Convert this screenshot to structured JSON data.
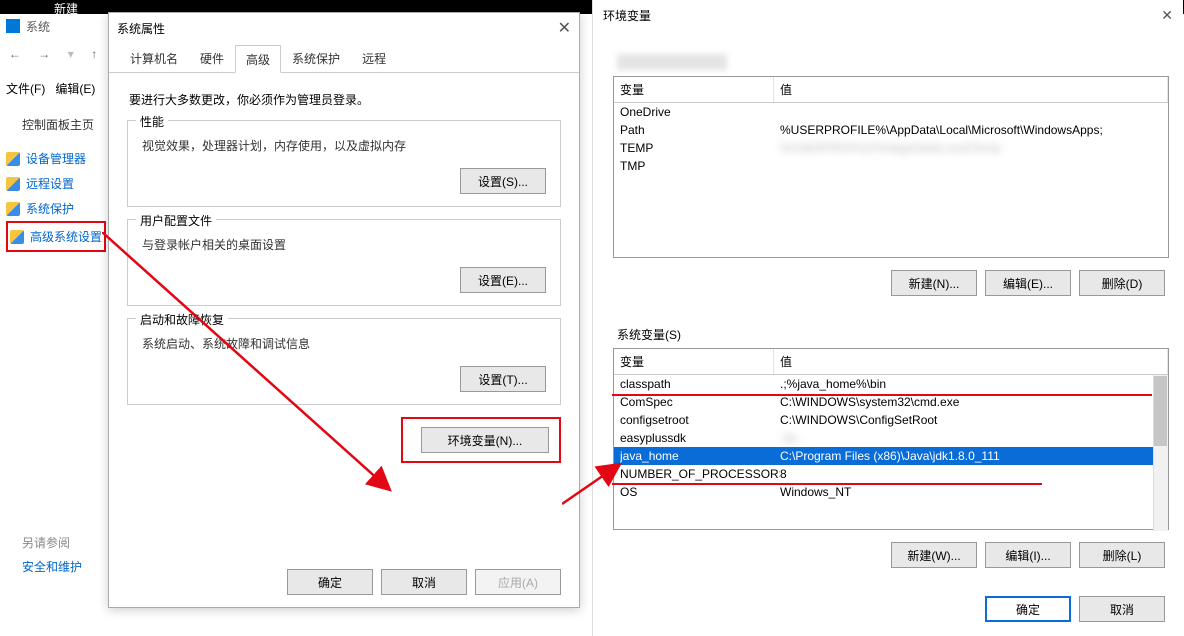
{
  "topbar": {
    "newtab": "新建"
  },
  "sysbar": {
    "label": "系统"
  },
  "menus": {
    "file": "文件(F)",
    "edit": "编辑(E)"
  },
  "nav_arrows": {
    "back": "←",
    "fwd": "→",
    "up": "↑"
  },
  "cp_home": "控制面板主页",
  "sidebar": {
    "items": [
      {
        "label": "设备管理器"
      },
      {
        "label": "远程设置"
      },
      {
        "label": "系统保护"
      },
      {
        "label": "高级系统设置"
      }
    ]
  },
  "seealso": "另请参阅",
  "sec_maint": "安全和维护",
  "sysprop": {
    "title": "系统属性",
    "tabs": {
      "computer_name": "计算机名",
      "hardware": "硬件",
      "advanced": "高级",
      "protection": "系统保护",
      "remote": "远程"
    },
    "admin_note": "要进行大多数更改，你必须作为管理员登录。",
    "perf": {
      "title": "性能",
      "desc": "视觉效果，处理器计划，内存使用，以及虚拟内存",
      "btn": "设置(S)..."
    },
    "profile": {
      "title": "用户配置文件",
      "desc": "与登录帐户相关的桌面设置",
      "btn": "设置(E)..."
    },
    "startup": {
      "title": "启动和故障恢复",
      "desc": "系统启动、系统故障和调试信息",
      "btn": "设置(T)..."
    },
    "env_btn": "环境变量(N)...",
    "ok": "确定",
    "cancel": "取消",
    "apply": "应用(A)"
  },
  "env": {
    "title": "环境变量",
    "col_var": "变量",
    "col_val": "值",
    "user_rows": [
      {
        "var": "OneDrive",
        "val": "",
        "blur_val": true
      },
      {
        "var": "Path",
        "val": "%USERPROFILE%\\AppData\\Local\\Microsoft\\WindowsApps;"
      },
      {
        "var": "TEMP",
        "val": "%USERPROFILE%\\AppData\\Local\\Temp",
        "blur_val": true
      },
      {
        "var": "TMP",
        "val": "",
        "blur_val": true
      }
    ],
    "sys_label": "系统变量(S)",
    "sys_rows": [
      {
        "var": "classpath",
        "val": ".;%java_home%\\bin"
      },
      {
        "var": "ComSpec",
        "val": "C:\\WINDOWS\\system32\\cmd.exe"
      },
      {
        "var": "configsetroot",
        "val": "C:\\WINDOWS\\ConfigSetRoot"
      },
      {
        "var": "easyplussdk",
        "val": ";\\bi...",
        "blur_val": true
      },
      {
        "var": "java_home",
        "val": "C:\\Program Files (x86)\\Java\\jdk1.8.0_111",
        "selected": true
      },
      {
        "var": "NUMBER_OF_PROCESSORS",
        "val": "8"
      },
      {
        "var": "OS",
        "val": "Windows_NT"
      }
    ],
    "new": "新建(N)...",
    "edit": "编辑(E)...",
    "del": "删除(D)",
    "new2": "新建(W)...",
    "edit2": "编辑(I)...",
    "del2": "删除(L)",
    "ok": "确定",
    "cancel": "取消"
  }
}
